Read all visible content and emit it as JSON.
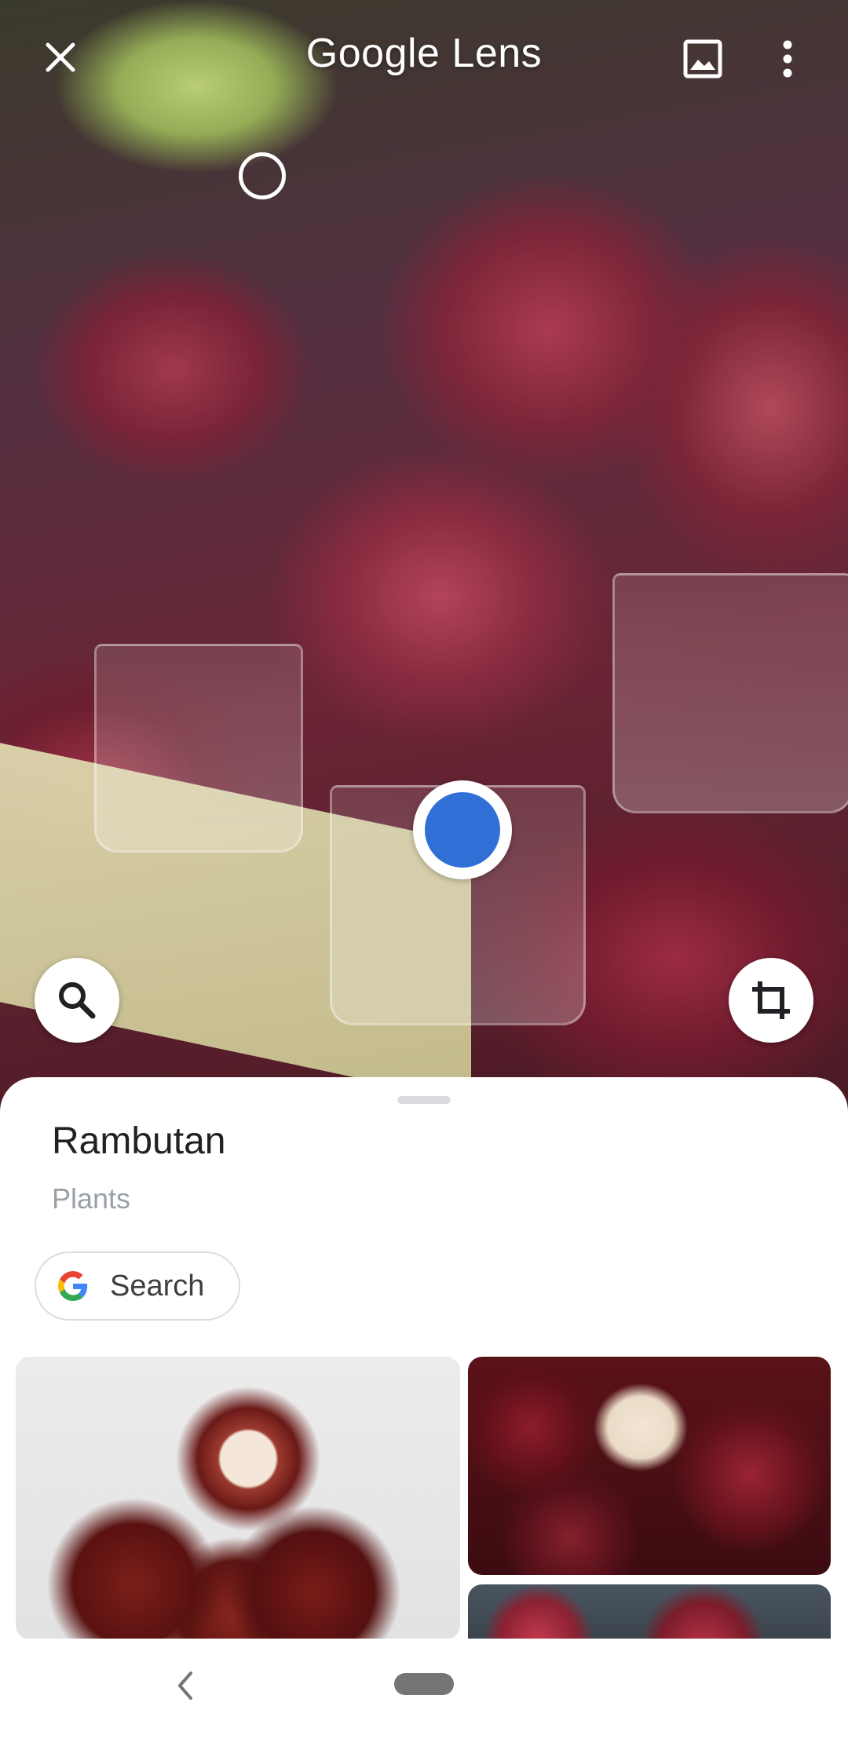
{
  "header": {
    "title": "Google Lens",
    "close_icon": "close-icon",
    "gallery_icon": "image-gallery-icon",
    "more_icon": "more-vert-icon"
  },
  "overlay": {
    "search_icon": "search-icon",
    "crop_icon": "crop-icon"
  },
  "result": {
    "title": "Rambutan",
    "category": "Plants",
    "search_chip_label": "Search",
    "search_chip_icon": "google-g-icon"
  },
  "nav": {
    "back_icon": "chevron-left-icon",
    "home_icon": "home-pill-icon"
  },
  "colors": {
    "accent_blue": "#2f6fd6",
    "title_text": "#202124",
    "secondary_text": "#9aa0a6"
  }
}
